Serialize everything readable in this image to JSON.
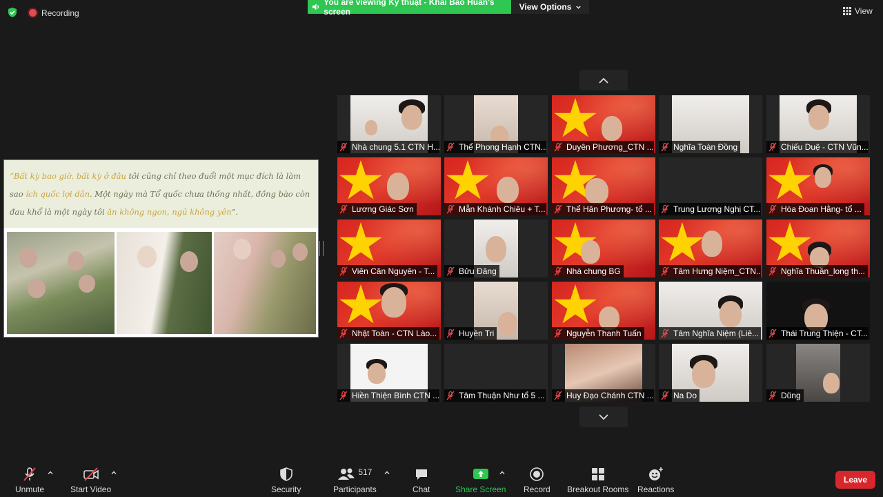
{
  "top": {
    "recording": "Recording",
    "banner": "You are viewing Kỹ thuật - Khải Bảo Huấn's screen",
    "view_options": "View Options",
    "view": "View"
  },
  "shared": {
    "quote_pre1": "“Bất kỳ bao giờ, bất kỳ ở đâu ",
    "quote_mid1": "tôi cũng chỉ theo đuổi một mục đích là làm sao ",
    "quote_hl1": "ích quốc lợi dân",
    "quote_mid2": ". Một ngày mà Tổ quốc chưa thống nhất, đồng bào còn đau khổ là một ngày tôi ",
    "quote_hl2": "ăn không ngon, ngủ không yên",
    "quote_end": "”."
  },
  "participants": [
    {
      "name": "Nhà chung 5.1 CTN H..."
    },
    {
      "name": "Thể Phong Hạnh CTN..."
    },
    {
      "name": "Duyên Phương_CTN ..."
    },
    {
      "name": "Nghĩa Toàn Đồng"
    },
    {
      "name": "Chiếu Duệ - CTN Vũn..."
    },
    {
      "name": "Lương Giác Sơn"
    },
    {
      "name": "Mẫn Khánh Chiêu + T..."
    },
    {
      "name": "Thể Hân Phương- tổ ..."
    },
    {
      "name": "Trung Lương Nghị CT..."
    },
    {
      "name": "Hòa Đoan Hằng- tổ ..."
    },
    {
      "name": "Viên Căn Nguyên - T..."
    },
    {
      "name": "Bửu Đăng"
    },
    {
      "name": "Nhà chung BG"
    },
    {
      "name": "Tâm Hưng Niệm_CTN..."
    },
    {
      "name": "Nghĩa Thuần_long th..."
    },
    {
      "name": "Nhật Toàn - CTN Lào..."
    },
    {
      "name": "Huyền Tri"
    },
    {
      "name": "Nguyễn Thanh Tuấn"
    },
    {
      "name": "Tâm Nghĩa Niệm (Liê..."
    },
    {
      "name": "Thái Trung Thiện - CT..."
    },
    {
      "name": "Hiền Thiện Bình  CTN ..."
    },
    {
      "name": "Tâm Thuận Như tổ 5 ..."
    },
    {
      "name": "Huy Đạo Chánh CTN ..."
    },
    {
      "name": "Na Do"
    },
    {
      "name": "Dũng"
    }
  ],
  "toolbar": {
    "unmute": "Unmute",
    "start_video": "Start Video",
    "security": "Security",
    "participants": "Participants",
    "participant_count": "517",
    "chat": "Chat",
    "share_screen": "Share Screen",
    "record": "Record",
    "breakout_rooms": "Breakout Rooms",
    "reactions": "Reactions",
    "leave": "Leave"
  },
  "colors": {
    "banner": "#2fc652",
    "leave": "#d8272c",
    "share": "#2fc652",
    "muted": "#e5484d"
  }
}
